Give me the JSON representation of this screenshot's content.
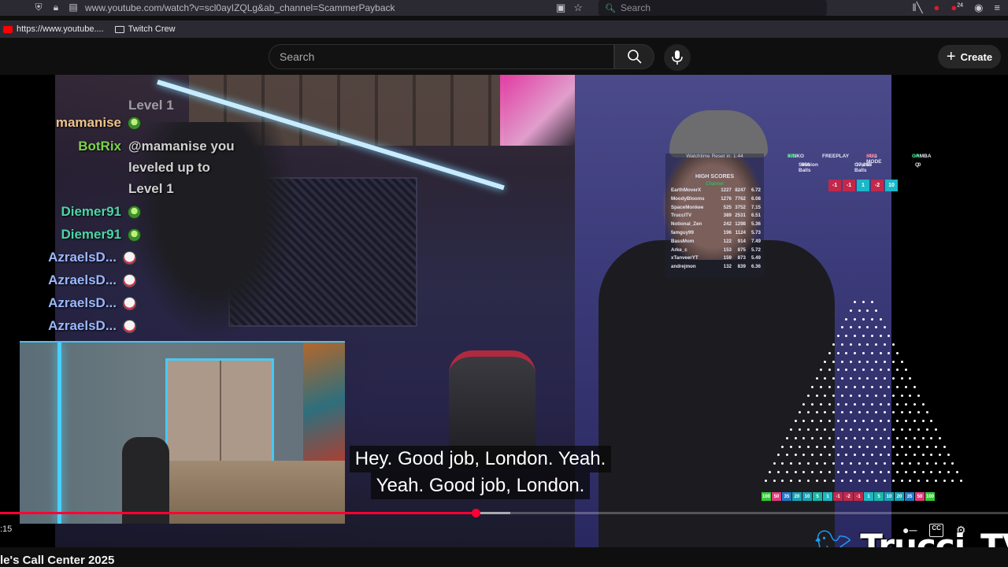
{
  "browser": {
    "url": "www.youtube.com/watch?v=scl0ayIZQLg&ab_channel=ScammerPayback",
    "search_placeholder": "Search",
    "notification_badge": "24",
    "bookmarks": [
      {
        "label": "https://www.youtube...."
      },
      {
        "label": "Twitch Crew"
      }
    ]
  },
  "youtube": {
    "search_placeholder": "Search",
    "create_label": "Create"
  },
  "chat": {
    "fragment": "Level 1",
    "messages": [
      {
        "name": "mamanise",
        "color": "#f0c38a",
        "emote": "green"
      },
      {
        "name": "BotRix",
        "color": "#7ad44a",
        "text_lines": [
          "@mamanise you",
          "leveled up to",
          "Level 1"
        ]
      },
      {
        "name": "Diemer91",
        "color": "#4bd6a8",
        "emote": "green"
      },
      {
        "name": "Diemer91",
        "color": "#4bd6a8",
        "emote": "green"
      },
      {
        "name": "AzraelsD...",
        "color": "#9ab8ff",
        "emote": "skull"
      },
      {
        "name": "AzraelsD...",
        "color": "#9ab8ff",
        "emote": "skull"
      },
      {
        "name": "AzraelsD...",
        "color": "#9ab8ff",
        "emote": "skull"
      },
      {
        "name": "AzraelsD...",
        "color": "#9ab8ff",
        "emote": "skull"
      }
    ]
  },
  "subtitles": [
    "Hey. Good job, London. Yeah.",
    "Yeah. Good job, London."
  ],
  "scoreboard": {
    "reset_text": "Watchtime Reset in: 1:44",
    "title": "HIGH SCORES",
    "channel_label": "Channel",
    "rows": [
      {
        "name": "EarthMoverX",
        "a": "1227",
        "b": "8247",
        "c": "6.72"
      },
      {
        "name": "MoodyBlooms",
        "a": "1276",
        "b": "7762",
        "c": "6.08"
      },
      {
        "name": "SpaceMonkee",
        "a": "525",
        "b": "3752",
        "c": "7.15"
      },
      {
        "name": "TrucciTV",
        "a": "389",
        "b": "2531",
        "c": "6.51"
      },
      {
        "name": "Notional_Zen",
        "a": "242",
        "b": "1298",
        "c": "5.36"
      },
      {
        "name": "famguy99",
        "a": "196",
        "b": "1124",
        "c": "5.73"
      },
      {
        "name": "BassMom",
        "a": "122",
        "b": "914",
        "c": "7.49"
      },
      {
        "name": "Arke_c",
        "a": "153",
        "b": "875",
        "c": "5.72"
      },
      {
        "name": "xTanveerYT",
        "a": "159",
        "b": "873",
        "c": "5.49"
      },
      {
        "name": "andrejmon",
        "a": "132",
        "b": "839",
        "c": "6.36"
      }
    ]
  },
  "stats": {
    "kinko": "KINKO",
    "kinko_state": "ON",
    "freeplay": "FREEPLAY",
    "submode": "SUB MODE",
    "submode_state": "OFF",
    "gamba": "GAMBA",
    "gamba_state": "ON",
    "session_label": "Session Balls",
    "session_value": "950",
    "overall_label": "Overall Balls",
    "overall_value": "17,265",
    "q_label": "Q",
    "q_value": "0"
  },
  "top_tiles": [
    {
      "label": "-1",
      "color": "#c2284a"
    },
    {
      "label": "-1",
      "color": "#c2284a"
    },
    {
      "label": "1",
      "color": "#19b7c8"
    },
    {
      "label": "-2",
      "color": "#c2284a"
    },
    {
      "label": "10",
      "color": "#19b7c8"
    }
  ],
  "bottom_tiles": [
    {
      "label": "100",
      "color": "#36c936"
    },
    {
      "label": "50",
      "color": "#e03a7a"
    },
    {
      "label": "35",
      "color": "#2477c4"
    },
    {
      "label": "20",
      "color": "#1ba3b5"
    },
    {
      "label": "10",
      "color": "#1ba3b5"
    },
    {
      "label": "5",
      "color": "#19b7a8"
    },
    {
      "label": "1",
      "color": "#1bb8c2"
    },
    {
      "label": "-1",
      "color": "#c2284a"
    },
    {
      "label": "-2",
      "color": "#c2284a"
    },
    {
      "label": "-1",
      "color": "#c2284a"
    },
    {
      "label": "1",
      "color": "#1bb8c2"
    },
    {
      "label": "5",
      "color": "#19b7a8"
    },
    {
      "label": "10",
      "color": "#1ba3b5"
    },
    {
      "label": "20",
      "color": "#1ba3b5"
    },
    {
      "label": "35",
      "color": "#2477c4"
    },
    {
      "label": "50",
      "color": "#e03a7a"
    },
    {
      "label": "100",
      "color": "#36c936"
    }
  ],
  "player": {
    "time": ":15",
    "progress_fraction": 0.472,
    "buffer_fraction": 0.506
  },
  "branding": {
    "name": "Trucci_TV"
  },
  "video_title": "le's Call Center 2025"
}
